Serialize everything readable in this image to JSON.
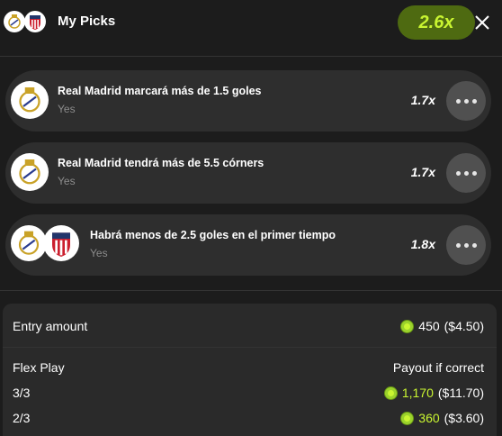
{
  "header": {
    "title": "My Picks",
    "multiplier": "2.6x"
  },
  "picks": [
    {
      "title": "Real Madrid marcará más de 1.5 goles",
      "selection": "Yes",
      "multiplier": "1.7x"
    },
    {
      "title": "Real Madrid tendrá más de 5.5 córners",
      "selection": "Yes",
      "multiplier": "1.7x"
    },
    {
      "title": "Habrá menos de 2.5 goles en el primer tiempo",
      "selection": "Yes",
      "multiplier": "1.8x"
    }
  ],
  "summary": {
    "entry_label": "Entry amount",
    "entry_coins": "450",
    "entry_usd": "($4.50)",
    "flex_label": "Flex Play",
    "payout_label": "Payout if correct",
    "rows": [
      {
        "label": "3/3",
        "coins": "1,170",
        "usd": "($11.70)"
      },
      {
        "label": "2/3",
        "coins": "360",
        "usd": "($3.60)"
      }
    ]
  },
  "icons": {
    "team_a": "real-madrid-crest-icon",
    "team_b": "atletico-madrid-crest-icon",
    "coin": "coin-icon",
    "close": "close-icon",
    "more": "more-options-icon"
  },
  "colors": {
    "background": "#1c1c1c",
    "card": "#2e2e2e",
    "accent_green": "#c9f531",
    "pill_bg": "#4e6a11"
  }
}
